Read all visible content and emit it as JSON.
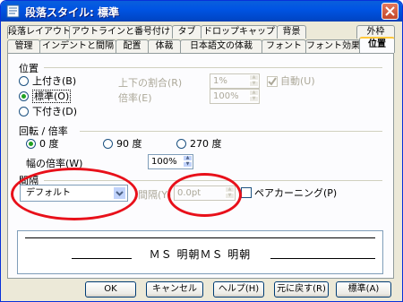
{
  "window": {
    "title": "段落スタイル: 標準",
    "colors": {
      "titlebar": "#0054e3",
      "highlight": "#e8101a",
      "active_tab_accent": "#ffc83c"
    }
  },
  "tabs": {
    "row1": [
      "段落レイアウト",
      "アウトラインと番号付け",
      "タブ",
      "ドロップキャップ",
      "背景",
      "外枠"
    ],
    "row2": [
      "管理",
      "インデントと間隔",
      "配置",
      "体裁",
      "日本語文の体裁",
      "フォント",
      "フォント効果",
      "位置"
    ],
    "active": "位置"
  },
  "position": {
    "title": "位置",
    "options": [
      {
        "label": "上付き(B)",
        "selected": false
      },
      {
        "label": "標準(O)",
        "selected": true
      },
      {
        "label": "下付き(D)",
        "selected": false
      }
    ],
    "raise_lower_label": "上下の割合(R)",
    "raise_lower_value": "1%",
    "auto_label": "自動(U)",
    "auto_checked": true,
    "scale_label": "倍率(E)",
    "scale_value": "100%"
  },
  "rotation": {
    "title": "回転 / 倍率",
    "options": [
      {
        "label": "0 度",
        "selected": true
      },
      {
        "label": "90 度",
        "selected": false
      },
      {
        "label": "270 度",
        "selected": false
      }
    ],
    "width_label": "幅の倍率(W)",
    "width_value": "100%"
  },
  "spacing": {
    "title": "間隔",
    "select_value": "デフォルト",
    "by_label": "間隔(Y)",
    "by_value": "0.0pt",
    "pair_kerning_label": "ペアカーニング(P)",
    "pair_kerning_checked": false
  },
  "preview": {
    "text": "ＭＳ 明朝ＭＳ 明朝"
  },
  "buttons": [
    "OK",
    "キャンセル",
    "ヘルプ(H)",
    "元に戻す(R)",
    "標準(A)"
  ]
}
